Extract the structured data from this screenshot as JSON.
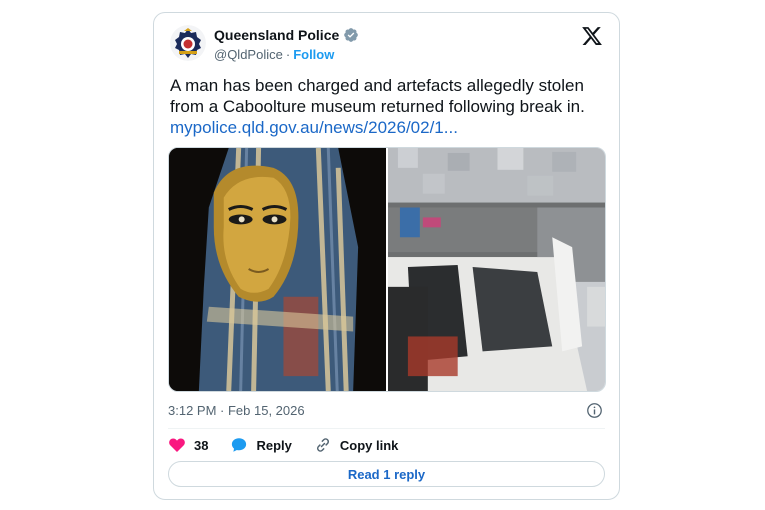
{
  "author": {
    "display_name": "Queensland Police",
    "handle": "@QldPolice",
    "separator": "·",
    "follow_label": "Follow"
  },
  "tweet": {
    "line1": "A man has been charged and artefacts allegedly stolen",
    "line2": "from a Caboolture museum returned following break in.",
    "link": "mypolice.qld.gov.au/news/2026/02/1..."
  },
  "timestamp": "3:12 PM · Feb 15, 2026",
  "actions": {
    "like_count": "38",
    "reply_label": "Reply",
    "copy_label": "Copy link"
  },
  "read_reply_label": "Read 1 reply",
  "colors": {
    "accent": "#1d9bf0",
    "link": "#1b68c7",
    "like": "#f91880"
  },
  "icons": [
    "police-badge-icon",
    "verified-icon",
    "x-logo-icon",
    "info-icon",
    "heart-icon",
    "reply-bubble-icon",
    "link-icon"
  ]
}
